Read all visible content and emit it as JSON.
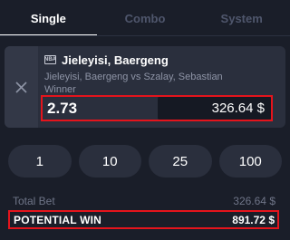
{
  "tabs": [
    {
      "label": "Single",
      "active": true
    },
    {
      "label": "Combo",
      "active": false
    },
    {
      "label": "System",
      "active": false
    }
  ],
  "bet": {
    "league_icon": "NBA",
    "selection": "Jieleyisi, Baergeng",
    "match": "Jieleyisi, Baergeng vs Szalay, Sebastian",
    "market": "Winner",
    "odds": "2.73",
    "stake": "326.64 $",
    "remove_icon": "close-icon"
  },
  "quick_amounts": [
    "1",
    "10",
    "25",
    "100"
  ],
  "totals": {
    "total_bet_label": "Total Bet",
    "total_bet_value": "326.64 $",
    "potential_win_label": "POTENTIAL WIN",
    "potential_win_value": "891.72 $"
  },
  "colors": {
    "background": "#1a1e29",
    "card": "#2a2f3d",
    "highlight": "#e4141c",
    "inactive_tab": "#4f566c"
  }
}
